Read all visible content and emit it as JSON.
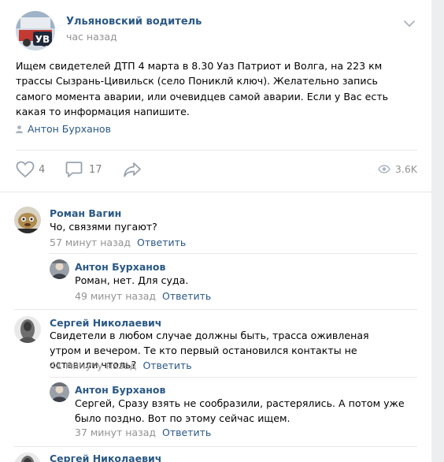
{
  "post": {
    "author": "Ульяновский водитель",
    "time": "час назад",
    "text": "Ищем свидетелей ДТП 4 марта в 8.30 Уаз Патриот и Волга, на 223 км трассы Сызрань-Цивильск (село Пониклй ключ). Желательно запись самого момента аварии, или очевидцев самой аварии. Если у Вас есть какая то информация напишите.",
    "signer": "Антон Бурханов",
    "avatar_text": "УВ",
    "likes": "4",
    "comments": "17",
    "views": "3.6K"
  },
  "reply_label": "Ответить",
  "comments": [
    {
      "author": "Роман Вагин",
      "text": "Чо, связями пугают?",
      "time": "57 минут назад"
    },
    {
      "author": "Антон Бурханов",
      "text": "Роман, нет. Для суда.",
      "time": "49 минут назад"
    },
    {
      "author": "Сергей Николаевич",
      "text": "Свидетели в любом случае должны быть, трасса оживленая утром и вечером. Те кто первый остановился контакты не оставили чтоль?",
      "time": "41 минуту назад"
    },
    {
      "author": "Антон Бурханов",
      "text": "Сергей, Сразу взять не сообразили, растерялись. А потом уже было поздно. Вот по этому сейчас ищем.",
      "time": "37 минут назад"
    },
    {
      "author": "Сергей Николаевич"
    }
  ],
  "colors": {
    "link": "#2a5885",
    "muted": "#939393",
    "icon": "#828282"
  },
  "icons": [
    "chevron-down-icon",
    "user-icon",
    "heart-icon",
    "comment-icon",
    "share-icon",
    "eye-icon"
  ]
}
